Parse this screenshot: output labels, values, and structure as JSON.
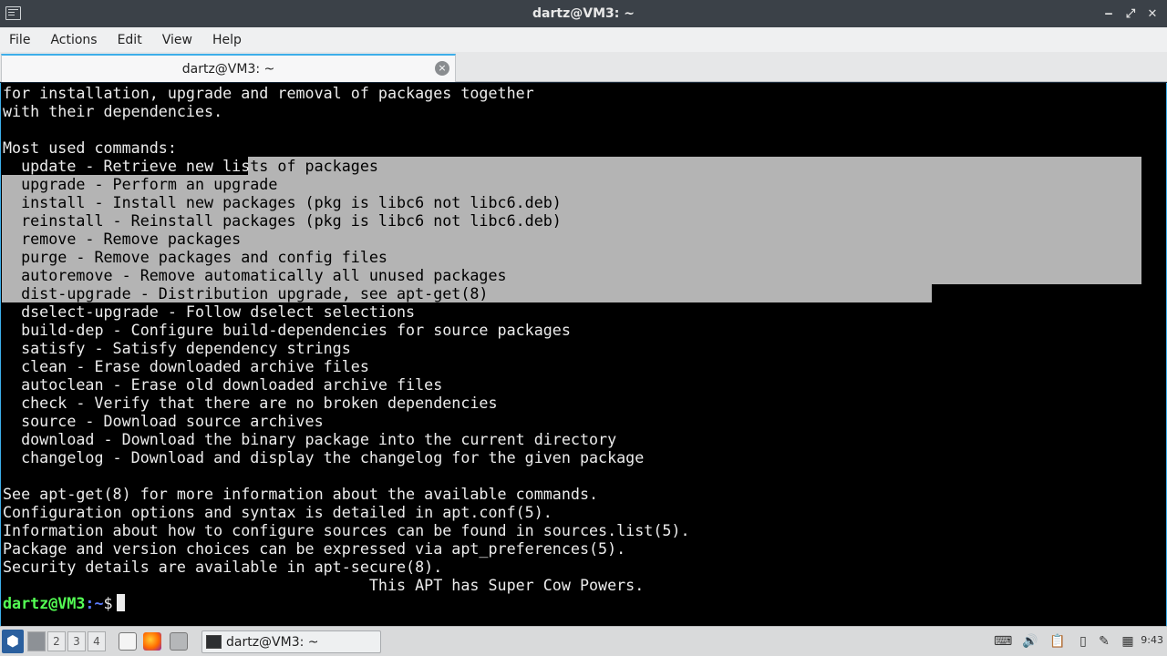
{
  "window": {
    "title": "dartz@VM3: ~",
    "controls": {
      "minimize": "‒",
      "maximize": "⤢",
      "close": "✕"
    }
  },
  "menu": [
    "File",
    "Actions",
    "Edit",
    "View",
    "Help"
  ],
  "tab": {
    "label": "dartz@VM3: ~",
    "close": "×"
  },
  "terminal": {
    "lines": [
      "for installation, upgrade and removal of packages together",
      "with their dependencies.",
      "",
      "Most used commands:",
      "  update - Retrieve new lists of packages",
      "  upgrade - Perform an upgrade",
      "  install - Install new packages (pkg is libc6 not libc6.deb)",
      "  reinstall - Reinstall packages (pkg is libc6 not libc6.deb)",
      "  remove - Remove packages",
      "  purge - Remove packages and config files",
      "  autoremove - Remove automatically all unused packages",
      "  dist-upgrade - Distribution upgrade, see apt-get(8)",
      "  dselect-upgrade - Follow dselect selections",
      "  build-dep - Configure build-dependencies for source packages",
      "  satisfy - Satisfy dependency strings",
      "  clean - Erase downloaded archive files",
      "  autoclean - Erase old downloaded archive files",
      "  check - Verify that there are no broken dependencies",
      "  source - Download source archives",
      "  download - Download the binary package into the current directory",
      "  changelog - Download and display the changelog for the given package",
      "",
      "See apt-get(8) for more information about the available commands.",
      "Configuration options and syntax is detailed in apt.conf(5).",
      "Information about how to configure sources can be found in sources.list(5).",
      "Package and version choices can be expressed via apt_preferences(5).",
      "Security details are available in apt-secure(8).",
      "                                        This APT has Super Cow Powers."
    ],
    "selected_line_indices": [
      4,
      5,
      6,
      7,
      8,
      9,
      10,
      11
    ],
    "prompt": {
      "user_host": "dartz@VM3",
      "path": ":~",
      "symbol": "$"
    }
  },
  "taskbar": {
    "start_icon": "lxqt-menu-icon",
    "workspaces": [
      "",
      "2",
      "3",
      "4"
    ],
    "active_workspace_index": 0,
    "quicklaunch": [
      "file-manager-icon",
      "firefox-icon",
      "folder-icon"
    ],
    "task_label": "dartz@VM3: ~",
    "tray": [
      "keyboard-icon",
      "volume-icon",
      "clipboard-icon",
      "network-icon",
      "settings-icon"
    ],
    "clock": "9:43"
  },
  "colors": {
    "titlebar": "#3b4148",
    "terminal_bg": "#000000",
    "terminal_fg": "#ececec",
    "selection": "#b4b4b4",
    "prompt_user": "#54ff54",
    "prompt_path": "#5b7cff",
    "accent": "#3daee9"
  }
}
